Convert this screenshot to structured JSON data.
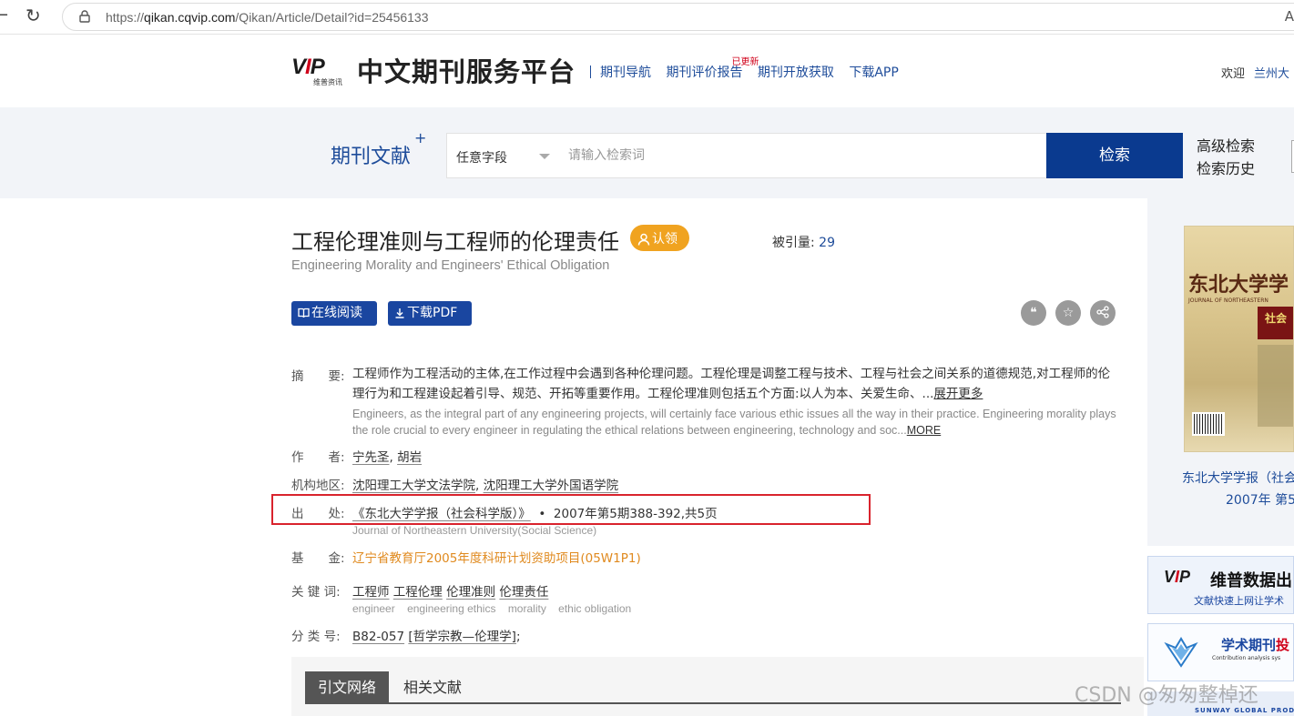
{
  "browser": {
    "url_prefix": "https://",
    "url_domain": "qikan.cqvip.com",
    "url_path": "/Qikan/Article/Detail?id=25456133"
  },
  "header": {
    "logo_text": "VIP",
    "logo_sub": "维普资讯",
    "site_title": "中文期刊服务平台",
    "nav": [
      {
        "label": "期刊导航"
      },
      {
        "label": "期刊评价报告",
        "badge": "已更新"
      },
      {
        "label": "期刊开放获取"
      },
      {
        "label": "下载APP"
      }
    ],
    "welcome": "欢迎",
    "user_org": "兰州大"
  },
  "search": {
    "section_title": "期刊文献",
    "section_plus": "+",
    "field_select": "任意字段",
    "placeholder": "请输入检索词",
    "button": "检索",
    "advanced": "高级检索",
    "history": "检索历史"
  },
  "article": {
    "title": "工程伦理准则与工程师的伦理责任",
    "claim": "认领",
    "cited_label": "被引量:",
    "cited_count": "29",
    "subtitle": "Engineering Morality and Engineers' Ethical Obligation",
    "read_button": "在线阅读",
    "pdf_button": "下载PDF",
    "abstract_label": "摘　　要:",
    "abstract_zh_1": "工程师作为工程活动的主体,在工作过程中会遇到各种伦理问题。工程伦理是调整工程与技术、工程与社会之间关系的道德规范,对工程师的伦理行为和工程建设起着引导、规范、开拓等重要作用。工程伦理准则包括五个方面:以人为本、关爱生命、...",
    "abstract_zh_more": "展开更多",
    "abstract_en": "Engineers, as the integral part of any engineering projects, will certainly face various ethic issues all the way in their practice. Engineering morality plays the role crucial to every engineer in regulating the ethical relations between engineering, technology and soc...",
    "abstract_en_more": "MORE",
    "authors_label": "作　　者:",
    "authors": [
      "宁先圣",
      "胡岩"
    ],
    "author_sep": ",",
    "org_label": "机构地区:",
    "orgs": [
      "沈阳理工大学文法学院",
      "沈阳理工大学外国语学院"
    ],
    "source_label": "出　　处:",
    "source_journal": "《东北大学学报（社会科学版）》",
    "source_dot": "•",
    "source_issue": "2007年第5期388-392,共5页",
    "source_en": "Journal of Northeastern University(Social Science)",
    "fund_label": "基　　金:",
    "fund": "辽宁省教育厅2005年度科研计划资助项目(05W1P1)",
    "keywords_label": "关 键 词:",
    "keywords": [
      "工程师",
      "工程伦理",
      "伦理准则",
      "伦理责任"
    ],
    "keywords_en": [
      "engineer",
      "engineering ethics",
      "morality",
      "ethic obligation"
    ],
    "class_label": "分 类 号:",
    "class_code": "B82-057",
    "class_name": "[哲学宗教—伦理学]",
    "class_end": ";"
  },
  "tabs": [
    {
      "label": "引文网络"
    },
    {
      "label": "相关文献"
    }
  ],
  "sidebar": {
    "cover_title": "东北大学学",
    "cover_en": "JOURNAL OF NORTHEASTERN",
    "cover_stripe": "社会",
    "caption_line1": "东北大学学报（社会",
    "caption_line2": "2007年 第5期",
    "ad1_logo": "VIP",
    "ad1_title": "维普数据出",
    "ad1_sub": "文献快速上网让学术",
    "ad2_title_a": "学术期刊",
    "ad2_title_b": "投",
    "ad2_sub": "Contribution analysis sys",
    "ad3_text": "SUNWAY GLOBAL PRODUCTS"
  },
  "watermark": "CSDN @匆匆整棹还",
  "colors": {
    "brand_blue": "#0a3a8f",
    "link_blue": "#1e4c9a",
    "claim_orange": "#f0a320",
    "fund_orange": "#e08a1f",
    "highlight_red": "#d9232d"
  }
}
